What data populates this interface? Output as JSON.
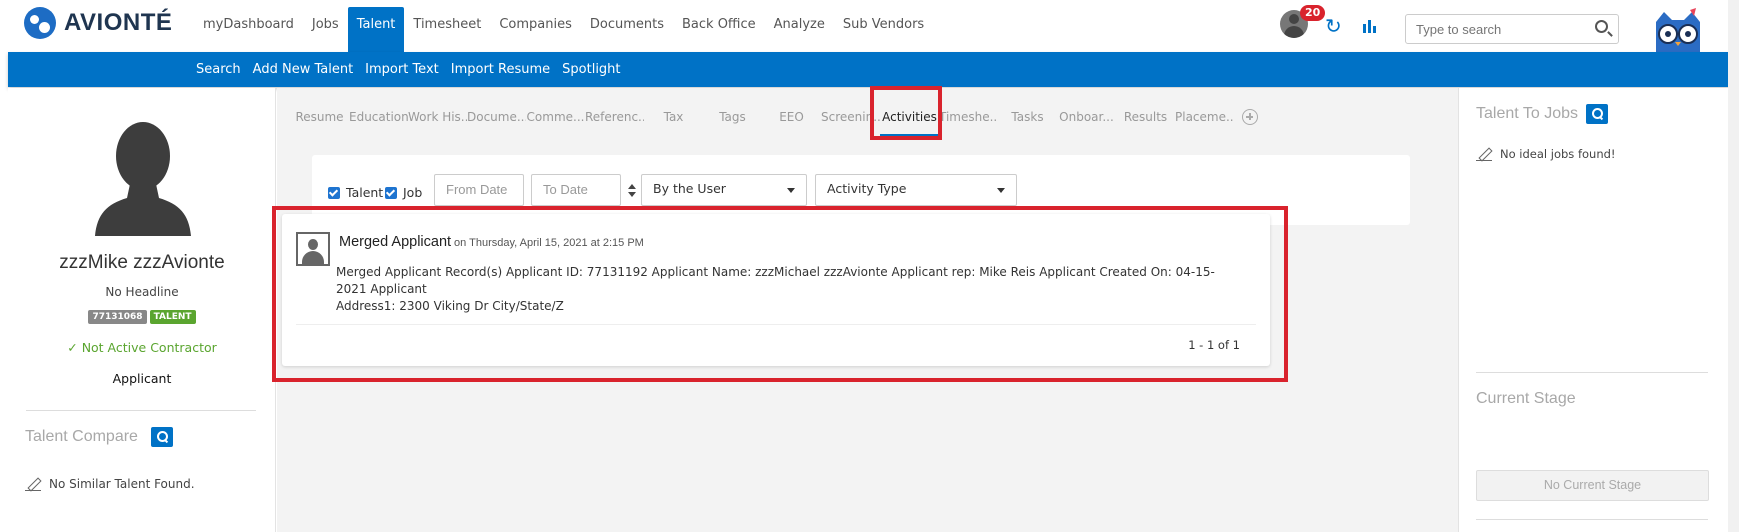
{
  "brand": {
    "name": "AVIONTÉ",
    "accent": "#0072c6",
    "highlight": "#d9232d"
  },
  "mainnav": [
    "myDashboard",
    "Jobs",
    "Talent",
    "Timesheet",
    "Companies",
    "Documents",
    "Back Office",
    "Analyze",
    "Sub Vendors"
  ],
  "header": {
    "notification_count": "20",
    "search_placeholder": "Type to search",
    "icons": [
      "user-avatar-icon",
      "refresh-icon",
      "analytics-icon",
      "search-icon",
      "owl-mascot-icon"
    ]
  },
  "subnav": [
    "Search",
    "Add New Talent",
    "Import Text",
    "Import Resume",
    "Spotlight"
  ],
  "profile": {
    "name": "zzzMike zzzAvionte",
    "headline": "No Headline",
    "id_tag": "77131068",
    "type_tag": "TALENT",
    "contractor_status": "Not Active Contractor",
    "status": "Applicant",
    "compare_title": "Talent Compare",
    "no_similar": "No Similar Talent Found."
  },
  "tabs": [
    "Resume",
    "Education",
    "Work His...",
    "Docume...",
    "Comme...",
    "Referenc...",
    "Tax",
    "Tags",
    "EEO",
    "Screenin...",
    "Activities",
    "Timeshe...",
    "Tasks",
    "Onboar...",
    "Results",
    "Placeme..."
  ],
  "active_tab": "Activities",
  "filters": {
    "talent_label": "Talent",
    "talent_checked": true,
    "job_label": "Job",
    "job_checked": true,
    "from_date_placeholder": "From Date",
    "to_date_placeholder": "To Date",
    "user_select": "By the User",
    "type_select": "Activity Type"
  },
  "activity": {
    "title": "Merged Applicant",
    "date": "on Thursday, April 15, 2021 at 2:15 PM",
    "body_line1": "Merged Applicant Record(s) Applicant ID: 77131192 Applicant Name: zzzMichael zzzAvionte Applicant rep: Mike Reis Applicant Created On: 04-15-2021 Applicant",
    "body_line2": "Address1: 2300 Viking Dr City/State/Z",
    "pager": "1 - 1 of 1"
  },
  "right_panel": {
    "talent_to_jobs_title": "Talent To Jobs",
    "no_jobs": "No ideal jobs found!",
    "current_stage_title": "Current Stage",
    "no_stage_button": "No Current Stage"
  }
}
